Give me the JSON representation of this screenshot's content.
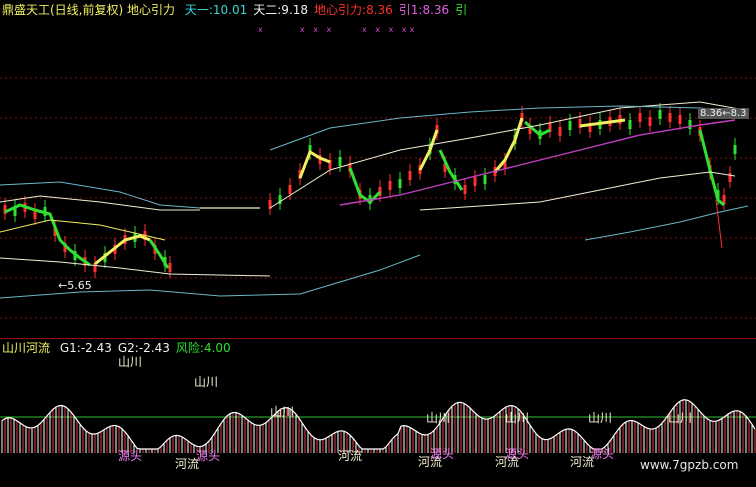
{
  "main_panel": {
    "title": "鼎盛天工(日线,前复权)",
    "indicator_name": "地心引力",
    "values": [
      {
        "label": "天一:",
        "value": "10.01",
        "color": "#3ad4d4"
      },
      {
        "label": "天二:",
        "value": "9.18",
        "color": "#f0f0f0"
      },
      {
        "label": "地心引力:",
        "value": "8.36",
        "color": "#ff3030"
      },
      {
        "label": "引1:",
        "value": "8.36",
        "color": "#e060e0"
      },
      {
        "label": "引",
        "value": "",
        "color": "#30e030"
      }
    ],
    "markers": [
      "x",
      "x x x",
      "x x x xx"
    ],
    "low_label": "←5.65",
    "price_label": "8.36←8.3"
  },
  "sub_panel": {
    "name": "山川河流",
    "values": [
      {
        "label": "G1:",
        "value": "-2.43",
        "color": "#f0f0f0"
      },
      {
        "label": "G2:",
        "value": "-2.43",
        "color": "#f0f0f0"
      },
      {
        "label": "风险:",
        "value": "4.00",
        "color": "#30e030"
      }
    ],
    "signal_labels": {
      "mountain": "山川",
      "river": "河流",
      "source": "源头"
    }
  },
  "watermark": "www.7gpzb.com",
  "colors": {
    "background": "#000000",
    "grid": "#8a0f0f",
    "bull_candle": "#ff3030",
    "bear_candle": "#30e030",
    "ma_yellow": "#f0f060",
    "ma_purple": "#c040c0",
    "band_cyan": "#6ab8c8",
    "band_white": "#f0f0d0",
    "histo_white": "#ffffff",
    "histo_red": "#e04040",
    "risk_line": "#30c030"
  }
}
